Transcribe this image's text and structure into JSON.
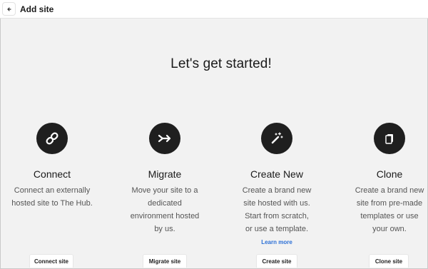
{
  "header": {
    "back_icon": "arrow-left-icon",
    "title": "Add site"
  },
  "main": {
    "headline": "Let's get started!"
  },
  "options": [
    {
      "icon": "link-icon",
      "title": "Connect",
      "description": "Connect an externally hosted site to The Hub.",
      "button": "Connect site"
    },
    {
      "icon": "migrate-arrow-icon",
      "title": "Migrate",
      "description": "Move your site to a dedicated environment hosted by us.",
      "button": "Migrate site"
    },
    {
      "icon": "magic-wand-icon",
      "title": "Create New",
      "description": "Create a brand new site hosted with us. Start from scratch, or use a template.",
      "link": "Learn more",
      "button": "Create site"
    },
    {
      "icon": "copy-pages-icon",
      "title": "Clone",
      "description": "Create a brand new site from pre-made templates or use your own.",
      "button": "Clone site"
    }
  ],
  "colors": {
    "background": "#f2f2f2",
    "icon_circle": "#1f1f1f",
    "link": "#2b6fd6"
  }
}
